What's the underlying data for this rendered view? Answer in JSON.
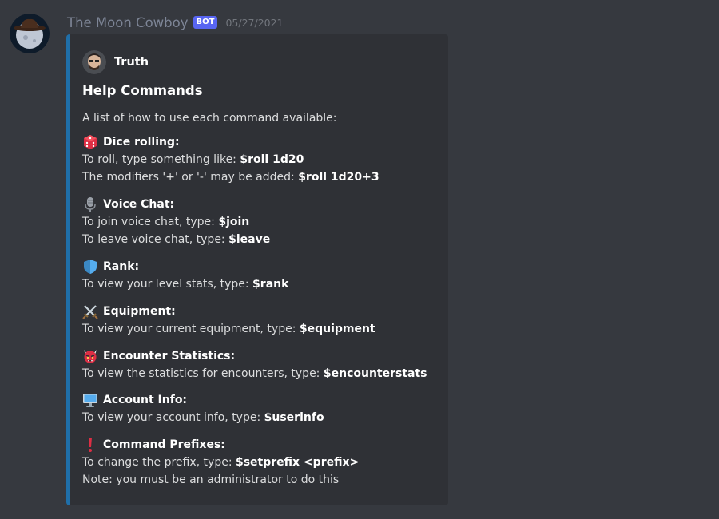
{
  "message": {
    "author": "The Moon Cowboy",
    "bot_tag": "BOT",
    "timestamp": "05/27/2021"
  },
  "embed": {
    "accent_color": "#1f6fa9",
    "author_name": "Truth",
    "title": "Help Commands",
    "description": "A list of how to use each command available:",
    "fields": [
      {
        "emoji": "dice-icon",
        "name": "Dice rolling:",
        "lines": [
          {
            "text": "To roll, type something like:",
            "command": "$roll 1d20"
          },
          {
            "text": "The modifiers '+' or '-' may be added:",
            "command": "$roll 1d20+3"
          }
        ]
      },
      {
        "emoji": "microphone-icon",
        "name": "Voice Chat:",
        "lines": [
          {
            "text": "To join voice chat, type:",
            "command": "$join"
          },
          {
            "text": "To leave voice chat, type:",
            "command": "$leave"
          }
        ]
      },
      {
        "emoji": "shield-icon",
        "name": "Rank:",
        "lines": [
          {
            "text": "To view your level stats, type:",
            "command": "$rank"
          }
        ]
      },
      {
        "emoji": "crossed-swords-icon",
        "name": "Equipment:",
        "lines": [
          {
            "text": "To view your current equipment, type:",
            "command": "$equipment"
          }
        ]
      },
      {
        "emoji": "ogre-icon",
        "name": "Encounter Statistics:",
        "lines": [
          {
            "text": "To view the statistics for encounters, type:",
            "command": "$encounterstats"
          }
        ]
      },
      {
        "emoji": "computer-icon",
        "name": "Account Info:",
        "lines": [
          {
            "text": "To view your account info, type:",
            "command": "$userinfo"
          }
        ]
      },
      {
        "emoji": "exclamation-icon",
        "name": "Command Prefixes:",
        "lines": [
          {
            "text": "To change the prefix, type:",
            "command": "$setprefix <prefix>"
          },
          {
            "text": "Note: you must be an administrator to do this",
            "command": ""
          }
        ]
      }
    ]
  }
}
